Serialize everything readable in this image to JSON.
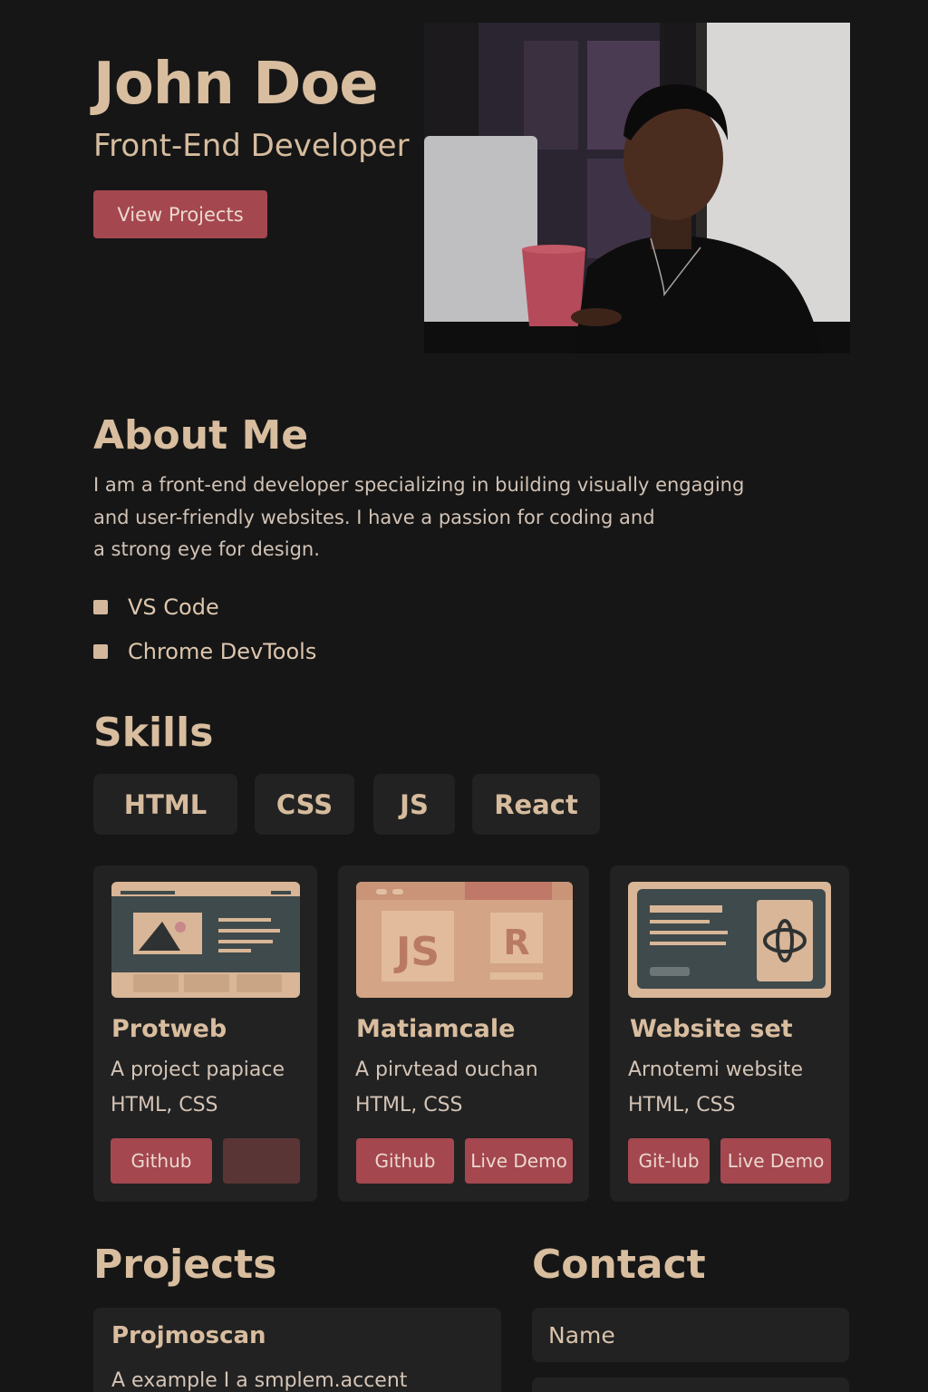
{
  "hero": {
    "name": "John Doe",
    "role": "Front-End Developer",
    "cta": "View Projects"
  },
  "about": {
    "heading": "About Me",
    "lines": [
      "I am a front-end developer specializing in building visually engaging",
      "and user-friendly websites. I have a passion for coding and",
      "a strong eye for design."
    ],
    "tools": [
      "VS Code",
      "Chrome DevTools"
    ]
  },
  "skills": {
    "heading": "Skills",
    "items": [
      "HTML",
      "CSS",
      "JS",
      "React"
    ]
  },
  "cards": [
    {
      "title": "Protweb",
      "desc": "A project papiace",
      "tech": "HTML, CSS",
      "github": "Github",
      "demo": ""
    },
    {
      "title": "Matiamcale",
      "desc": "A pirvtead ouchan",
      "tech": "HTML, CSS",
      "github": "Github",
      "demo": "Live Demo"
    },
    {
      "title": "Website set",
      "desc": "Arnotemi website",
      "tech": "HTML, CSS",
      "github": "Git-lub",
      "demo": "Live Demo"
    }
  ],
  "projects": {
    "heading": "Projects",
    "item_title": "Projmoscan",
    "item_desc": "A example I a smplem.accent"
  },
  "contact": {
    "heading": "Contact",
    "name_placeholder": "Name"
  },
  "colors": {
    "background": "#161616",
    "accent": "#a4474f",
    "text": "#d8bd9f",
    "card": "#222222"
  }
}
